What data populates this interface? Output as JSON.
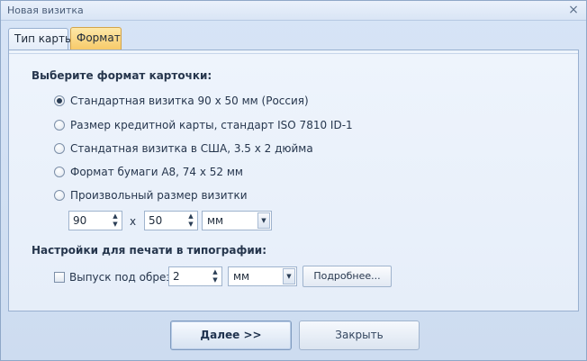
{
  "window": {
    "title": "Новая визитка",
    "close_glyph": "×"
  },
  "tabs": [
    {
      "label": "Тип карты",
      "active": false
    },
    {
      "label": "Формат",
      "active": true
    }
  ],
  "format": {
    "heading": "Выберите формат карточки:",
    "options": [
      {
        "label": "Стандартная визитка 90 x 50 мм (Россия)",
        "checked": true
      },
      {
        "label": "Размер кредитной карты, стандарт ISO 7810 ID-1",
        "checked": false
      },
      {
        "label": "Стандатная визитка в США, 3.5 x 2 дюйма",
        "checked": false
      },
      {
        "label": "Формат бумаги А8, 74 x 52 мм",
        "checked": false
      },
      {
        "label": "Произвольный размер визитки",
        "checked": false
      }
    ],
    "width_value": "90",
    "times_sign": "x",
    "height_value": "50",
    "unit": "мм"
  },
  "print": {
    "heading": "Настройки для печати в типографии:",
    "bleed_label": "Выпуск под обрез",
    "bleed_checked": false,
    "bleed_value": "2",
    "unit": "мм",
    "more_label": "Подробнее..."
  },
  "buttons": {
    "next": "Далее >>",
    "close": "Закрыть"
  },
  "icons": {
    "spin_up": "▲",
    "spin_down": "▼",
    "dropdown": "▼"
  }
}
